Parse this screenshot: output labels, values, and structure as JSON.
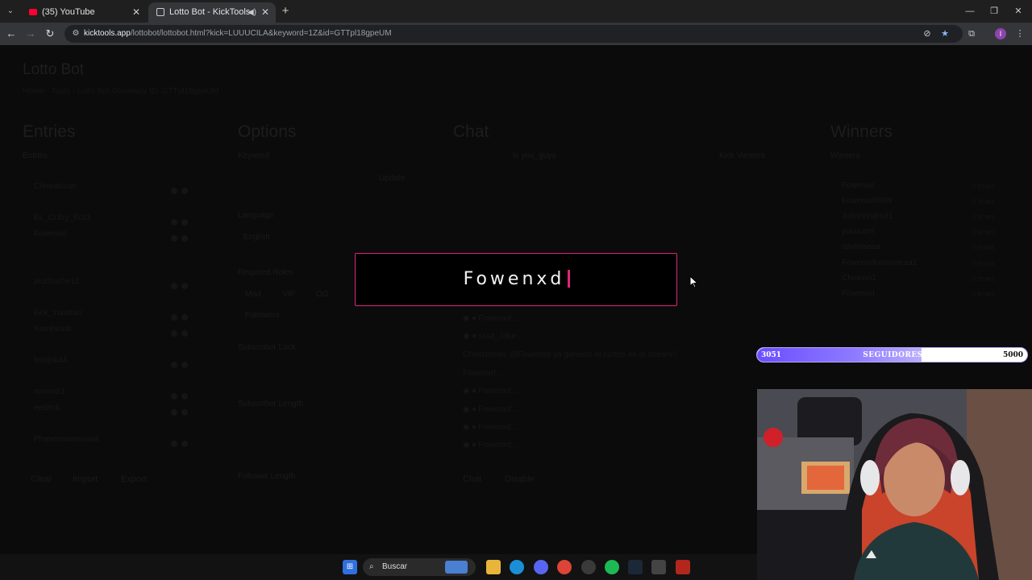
{
  "browser": {
    "tabs": [
      {
        "label": "(35) YouTube",
        "active": false
      },
      {
        "label": "Lotto Bot - KickTools",
        "active": true
      }
    ],
    "url_host": "kicktools.app",
    "url_path": "/lottobot/lottobot.html?kick=LUUUCILA&keyword=1Z&id=GTTpl18gpeUM"
  },
  "page": {
    "app_title": "Lotto Bot",
    "breadcrumb": "Home  ·  Tools  ·  Lotto Bot      Giveaway ID:  GTTpl18gpeUM",
    "columns": {
      "entries": "Entries",
      "options": "Options",
      "chat": "Chat",
      "winners": "Winners"
    },
    "entries_sub": "Entries",
    "options": {
      "keyword_label": "Keyword",
      "update_btn": "Update",
      "language_label": "Language",
      "language_value": "English",
      "required_roles_label": "Required Roles",
      "roles": [
        "Mod",
        "VIP",
        "OG"
      ],
      "followers_label": "Followers",
      "sub_luck_label": "Subscriber Luck",
      "sub_length_label": "Subscriber Length",
      "follower_length_label": "Follower Length"
    },
    "entries_list": [
      "Chinnitocan",
      "EL_Cr4zy_Fr33",
      "Fowenxd",
      "piuchuche12",
      "Eek_Yunatan",
      "KamiNoob",
      "froojok44",
      "mnmnb1",
      "eedrick",
      "Phasesmannnasa"
    ],
    "entries_buttons": [
      "Clear",
      "Import",
      "Export"
    ],
    "chat_header": "Is you_guys",
    "chat_right": "Kick Viewers",
    "chat_lines": [
      "◉ ♦ Fowenxd  ...",
      "◉ ♦ sssz_Jake  ...",
      "Chinnitocan: @Fowenxd ya ganaste el sorteo en el stream!!",
      "Fowenxd: ...",
      "◉ ♦ Fowenxd: ...",
      "◉ ♦ Fowenxd: ...",
      "◉ ♦ Fowenxd: ...",
      "◉ ♦ Fowenxd: ..."
    ],
    "chat_footer": [
      "Chat",
      "Disable"
    ],
    "winners_sub": "Winners",
    "winners": [
      {
        "name": "Fowenxd",
        "n": "0 times"
      },
      {
        "name": "Fowenxd9999",
        "n": "0 times"
      },
      {
        "name": "Johnnnnamd1",
        "n": "0 times"
      },
      {
        "name": "yuuuuzel",
        "n": "0 times"
      },
      {
        "name": "lalalalaaaa",
        "n": "0 times"
      },
      {
        "name": "Fowenxdnnnmaeaa1",
        "n": "0 times"
      },
      {
        "name": "Chinnnn1",
        "n": "0 times"
      },
      {
        "name": "Fowenxd",
        "n": "0 times"
      }
    ]
  },
  "popup": {
    "winner_name": "Fowenxd",
    "accent": "#e0247a"
  },
  "goal": {
    "current": "3051",
    "label": "SEGUIDORES",
    "target": "5000",
    "progress": 0.61
  },
  "taskbar": {
    "search_placeholder": "Buscar"
  }
}
